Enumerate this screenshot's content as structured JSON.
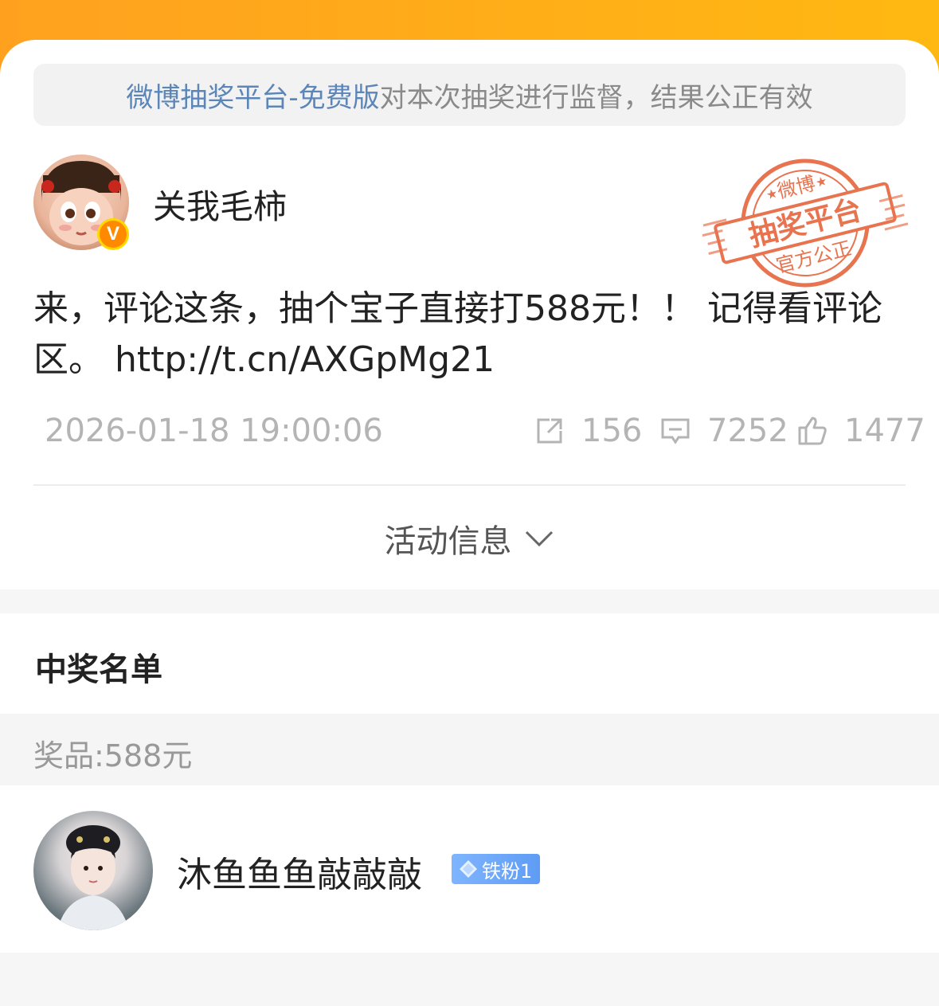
{
  "notice": {
    "platform": "微博抽奖平台-免费版",
    "text": " 对本次抽奖进行监督，结果公正有效"
  },
  "author": {
    "name": "关我毛柿",
    "verified_badge": "V"
  },
  "stamp": {
    "top": "微博",
    "middle": "抽奖平台",
    "bottom": "官方公正"
  },
  "post": {
    "text": "来，评论这条，抽个宝子直接打588元！！ 记得看评论区。  http://t.cn/AXGpMg21",
    "time": "2026-01-18 19:00:06",
    "reposts": "156",
    "comments": "7252",
    "likes": "1477"
  },
  "activity": {
    "label": "活动信息"
  },
  "winners": {
    "title": "中奖名单",
    "prize": "奖品:588元",
    "list": [
      {
        "name": "沐鱼鱼鱼敲敲敲",
        "badge": "铁粉1"
      }
    ]
  },
  "colors": {
    "brand_orange": "#ffa11f",
    "link_blue": "#5c86b8",
    "stamp_red": "#e8734f"
  }
}
